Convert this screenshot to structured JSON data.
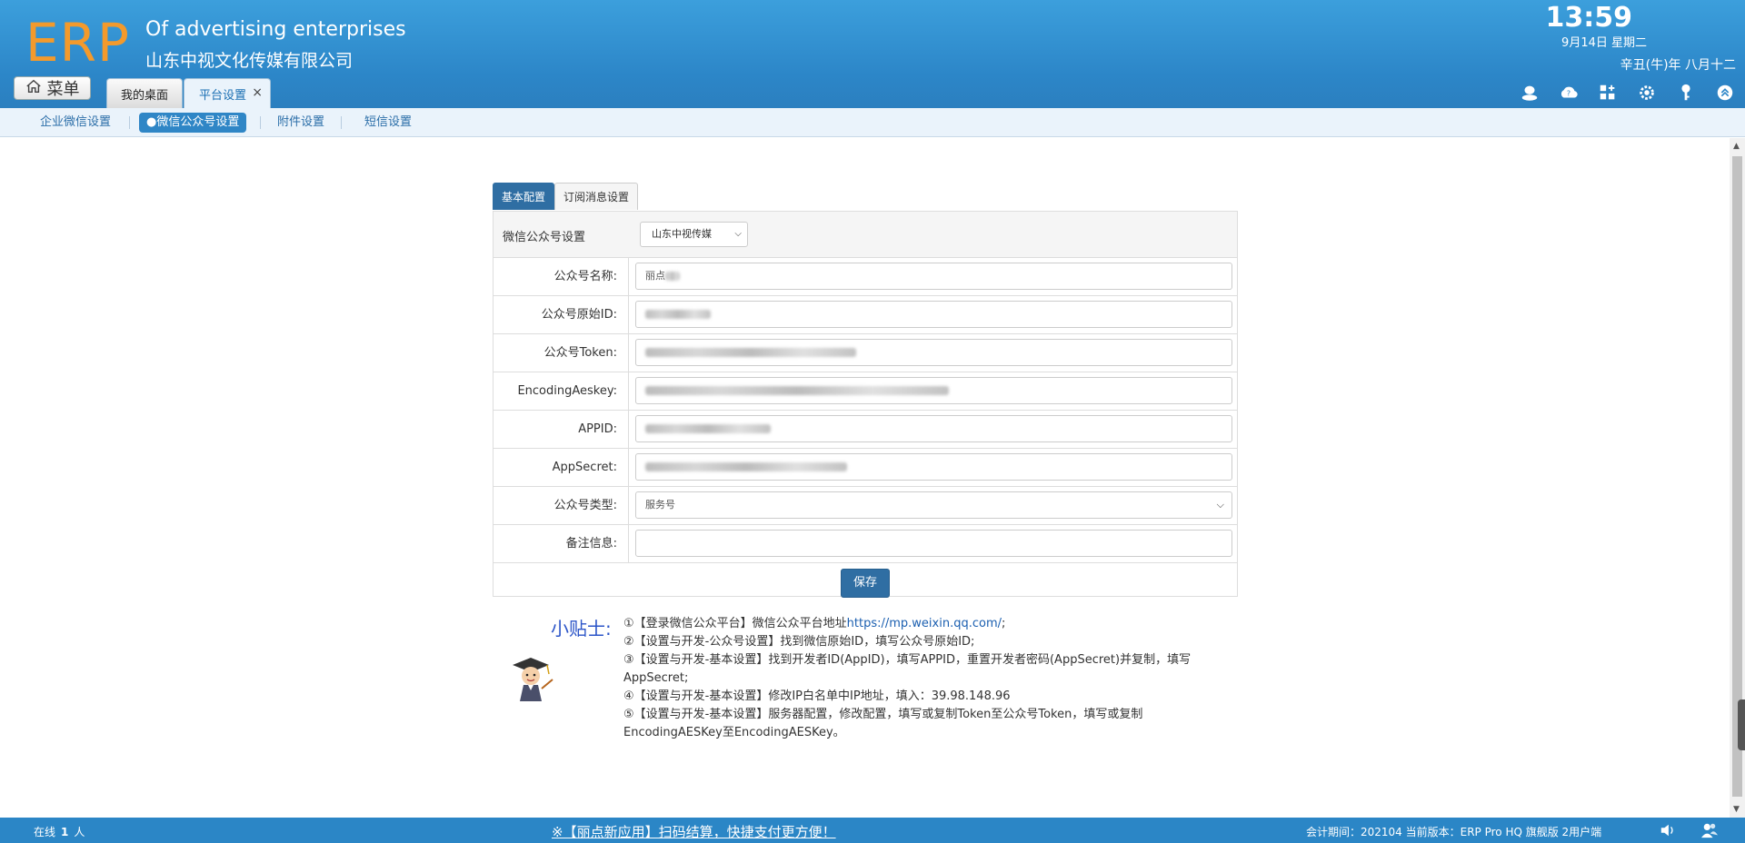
{
  "header": {
    "logo": "ERP",
    "company_en": "Of advertising enterprises",
    "company_cn": "山东中视文化传媒有限公司",
    "time": "13:59",
    "date": "9月14日 星期二",
    "lunar": "辛丑(牛)年 八月十二",
    "menu_label": "菜单",
    "tabs": [
      {
        "label": "我的桌面"
      },
      {
        "label": "平台设置",
        "close": "×"
      }
    ],
    "icons": [
      "user-icon",
      "cloud-help-icon",
      "grid-add-icon",
      "settings-icon",
      "key-icon",
      "collapse-icon"
    ]
  },
  "subnav": {
    "items": [
      {
        "label": "企业微信设置"
      },
      {
        "label": "●微信公众号设置"
      },
      {
        "label": "附件设置"
      },
      {
        "label": "短信设置"
      }
    ]
  },
  "form": {
    "tabs": [
      {
        "label": "基本配置"
      },
      {
        "label": "订阅消息设置"
      }
    ],
    "header_label": "微信公众号设置",
    "header_select": "山东中视传媒",
    "rows": [
      {
        "label": "公众号名称:",
        "value": "丽点"
      },
      {
        "label": "公众号原始ID:",
        "value": ""
      },
      {
        "label": "公众号Token:",
        "value": ""
      },
      {
        "label": "EncodingAeskey:",
        "value": ""
      },
      {
        "label": "APPID:",
        "value": ""
      },
      {
        "label": "AppSecret:",
        "value": ""
      },
      {
        "label": "公众号类型:",
        "value": "服务号"
      },
      {
        "label": "备注信息:",
        "value": ""
      }
    ],
    "save_label": "保存"
  },
  "tips": {
    "title": "小贴士:",
    "lines": [
      {
        "text": "①【登录微信公众平台】微信公众平台地址",
        "link": "https://mp.weixin.qq.com/",
        "suffix": ";"
      },
      {
        "text": "②【设置与开发-公众号设置】找到微信原始ID，填写公众号原始ID;"
      },
      {
        "text": "③【设置与开发-基本设置】找到开发者ID(AppID)，填写APPID，重置开发者密码(AppSecret)并复制，填写AppSecret;"
      },
      {
        "text": "④【设置与开发-基本设置】修改IP白名单中IP地址，填入：39.98.148.96"
      },
      {
        "text": "⑤【设置与开发-基本设置】服务器配置，修改配置，填写或复制Token至公众号Token，填写或复制EncodingAESKey至EncodingAESKey。"
      }
    ]
  },
  "footer": {
    "online_prefix": "在线",
    "online_count": "1",
    "online_suffix": "人",
    "marquee": "※【丽点新应用】扫码结算，快捷支付更方便！",
    "period": "会计期间：202104 当前版本：ERP Pro HQ 旗舰版 2用户端",
    "icons": [
      "speaker-icon",
      "users-icon"
    ]
  },
  "colors": {
    "header_blue": "#2c86c8",
    "logo_orange": "#f39a2c",
    "primary_button": "#2f6ea3",
    "tips_title": "#2b54c8",
    "footer_blue": "#2b86c6"
  }
}
